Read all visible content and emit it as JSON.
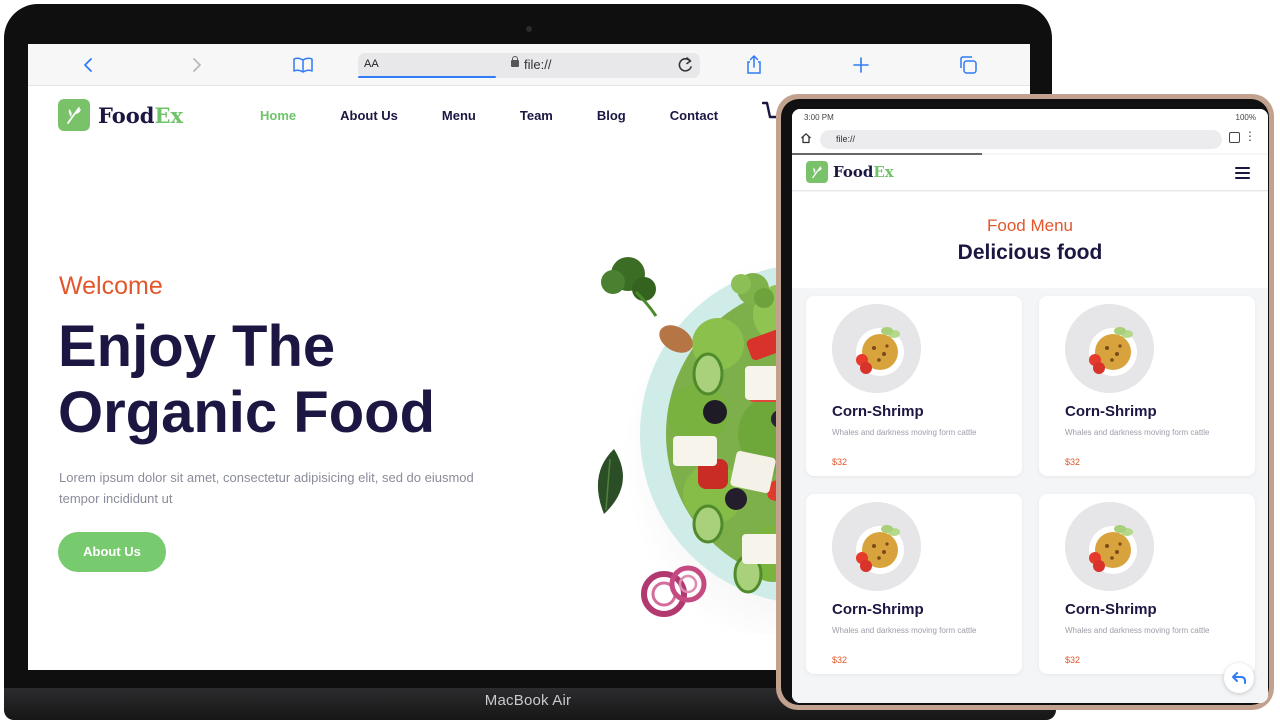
{
  "device_label": "MacBook Air",
  "browser": {
    "address_aa": "AA",
    "url": "file://",
    "icons": [
      "back-icon",
      "forward-icon",
      "bookmarks-icon",
      "lock-icon",
      "reload-icon",
      "share-icon",
      "new-tab-icon",
      "tabs-icon"
    ]
  },
  "site": {
    "logo_prefix": "Food",
    "logo_accent": "Ex",
    "nav": [
      "Home",
      "About Us",
      "Menu",
      "Team",
      "Blog",
      "Contact"
    ],
    "hero": {
      "kicker": "Welcome",
      "title_line1": "Enjoy The",
      "title_line2": "Organic Food",
      "text": "Lorem ipsum dolor sit amet, consectetur adipisicing elit, sed do eiusmod tempor incididunt ut",
      "button": "About Us"
    }
  },
  "tablet": {
    "status_time": "3:00 PM",
    "status_battery": "100%",
    "url": "file://",
    "section_kicker": "Food Menu",
    "section_title": "Delicious food",
    "items": [
      {
        "name": "Corn-Shrimp",
        "desc": "Whales and darkness moving form cattle",
        "price": "$32"
      },
      {
        "name": "Corn-Shrimp",
        "desc": "Whales and darkness moving form cattle",
        "price": "$32"
      },
      {
        "name": "Corn-Shrimp",
        "desc": "Whales and darkness moving form cattle",
        "price": "$32"
      },
      {
        "name": "Corn-Shrimp",
        "desc": "Whales and darkness moving form cattle",
        "price": "$32"
      }
    ]
  },
  "colors": {
    "brand_green": "#77ca6d",
    "accent_orange": "#e2572b",
    "navy": "#1b1742",
    "safari_blue": "#2f7cf6"
  }
}
